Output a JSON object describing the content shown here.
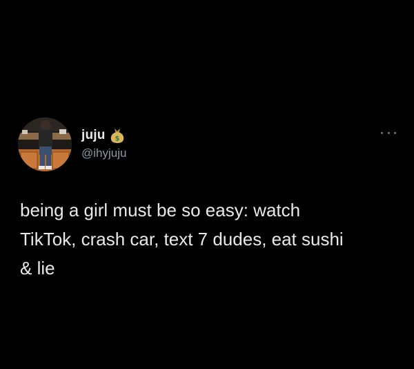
{
  "tweet": {
    "author": {
      "display_name": "juju",
      "name_emoji": "money-bag-icon",
      "handle": "@ihyjuju"
    },
    "text_lines": [
      "being a girl must be so easy: watch",
      "TikTok, crash car, text 7 dudes, eat sushi",
      "& lie"
    ],
    "more_menu": "more-options-icon"
  },
  "colors": {
    "background": "#000000",
    "primary_text": "#e7e9ea",
    "secondary_text": "#8b98a5",
    "icon_gray": "#6e767d"
  }
}
